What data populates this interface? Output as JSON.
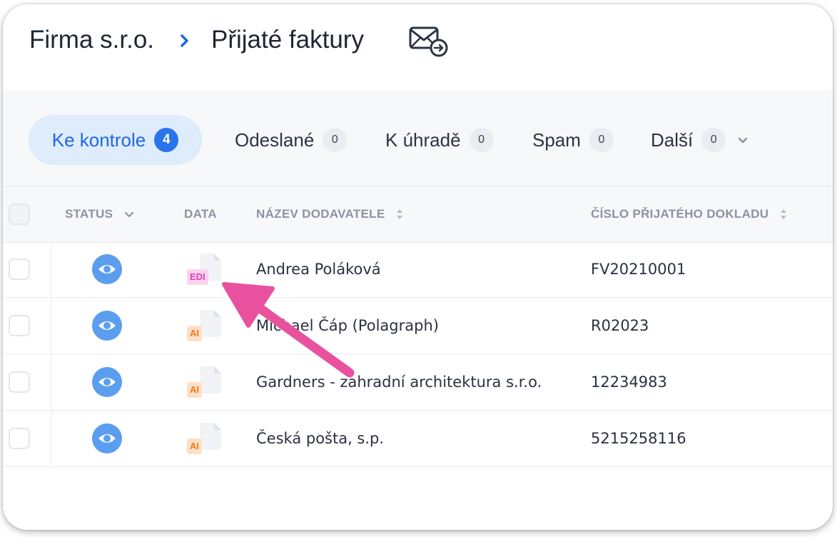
{
  "breadcrumb": {
    "company": "Firma s.r.o.",
    "page": "Přijaté faktury"
  },
  "filters": [
    {
      "label": "Ke kontrole",
      "count": "4",
      "active": true
    },
    {
      "label": "Odeslané",
      "count": "0"
    },
    {
      "label": "K úhradě",
      "count": "0"
    },
    {
      "label": "Spam",
      "count": "0"
    },
    {
      "label": "Další",
      "count": "0"
    }
  ],
  "table": {
    "columns": [
      "STATUS",
      "DATA",
      "NÁZEV DODAVATELE",
      "ČÍSLO PŘIJATÉHO DOKLADU"
    ],
    "rows": [
      {
        "data_type": "EDI",
        "supplier": "Andrea Poláková",
        "doc_number": "FV20210001"
      },
      {
        "data_type": "AI",
        "supplier": "Michael Čáp (Polagraph)",
        "doc_number": "R02023"
      },
      {
        "data_type": "AI",
        "supplier": "Gardners - zahradní architektura s.r.o.",
        "doc_number": "12234983"
      },
      {
        "data_type": "AI",
        "supplier": "Česká pošta, s.p.",
        "doc_number": "5215258116"
      }
    ]
  },
  "colors": {
    "accent": "#2b73e8",
    "status_eye": "#5b9ef0",
    "edi_label": "#e23fb3",
    "ai_label": "#f27a1d",
    "annotation_arrow": "#e9519f"
  },
  "icons": {
    "header_action": "mail-forward-icon",
    "status": "eye-icon",
    "data": "document-icon"
  }
}
